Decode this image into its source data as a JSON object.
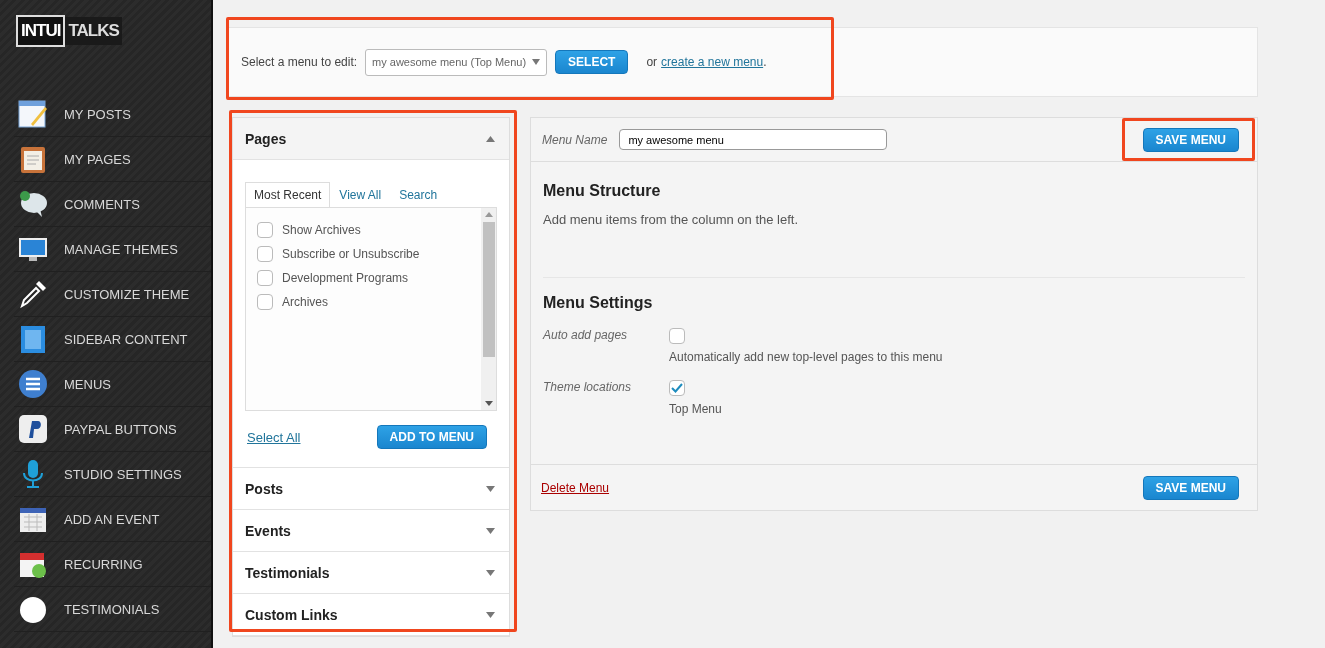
{
  "sidebar": {
    "logo": [
      "INTUI",
      "TALKS"
    ],
    "items": [
      {
        "label": "MY POSTS"
      },
      {
        "label": "MY PAGES"
      },
      {
        "label": "COMMENTS"
      },
      {
        "label": "MANAGE THEMES"
      },
      {
        "label": "CUSTOMIZE THEME"
      },
      {
        "label": "SIDEBAR CONTENT"
      },
      {
        "label": "MENUS"
      },
      {
        "label": "PAYPAL BUTTONS"
      },
      {
        "label": "STUDIO SETTINGS"
      },
      {
        "label": "ADD AN EVENT"
      },
      {
        "label": "RECURRING"
      },
      {
        "label": "TESTIMONIALS"
      }
    ]
  },
  "select_bar": {
    "label": "Select a menu to edit:",
    "value": "my awesome menu (Top Menu)",
    "button": "SELECT",
    "or_text": "or",
    "link": "create a new menu",
    "after_link": "."
  },
  "left_column": {
    "sections": [
      {
        "title": "Pages",
        "expanded": true,
        "tabs": [
          {
            "label": "Most Recent",
            "selected": true
          },
          {
            "label": "View All",
            "selected": false
          },
          {
            "label": "Search",
            "selected": false
          }
        ],
        "items": [
          {
            "label": "Show Archives",
            "checked": false
          },
          {
            "label": "Subscribe or Unsubscribe",
            "checked": false
          },
          {
            "label": "Development Programs",
            "checked": false
          },
          {
            "label": "Archives",
            "checked": false
          }
        ],
        "select_all": "Select All",
        "add_button": "ADD TO MENU"
      },
      {
        "title": "Posts",
        "expanded": false
      },
      {
        "title": "Events",
        "expanded": false
      },
      {
        "title": "Testimonials",
        "expanded": false
      },
      {
        "title": "Custom Links",
        "expanded": false
      }
    ]
  },
  "menu_panel": {
    "name_label": "Menu Name",
    "name_value": "my awesome menu",
    "save_button": "SAVE MENU",
    "structure_title": "Menu Structure",
    "structure_text": "Add menu items from the column on the left.",
    "settings_title": "Menu Settings",
    "settings": [
      {
        "label": "Auto add pages",
        "option": "Automatically add new top-level pages to this menu",
        "checked": false
      },
      {
        "label": "Theme locations",
        "option": "Top Menu",
        "checked": true
      }
    ],
    "delete_link": "Delete Menu",
    "footer_save_button": "SAVE MENU"
  }
}
